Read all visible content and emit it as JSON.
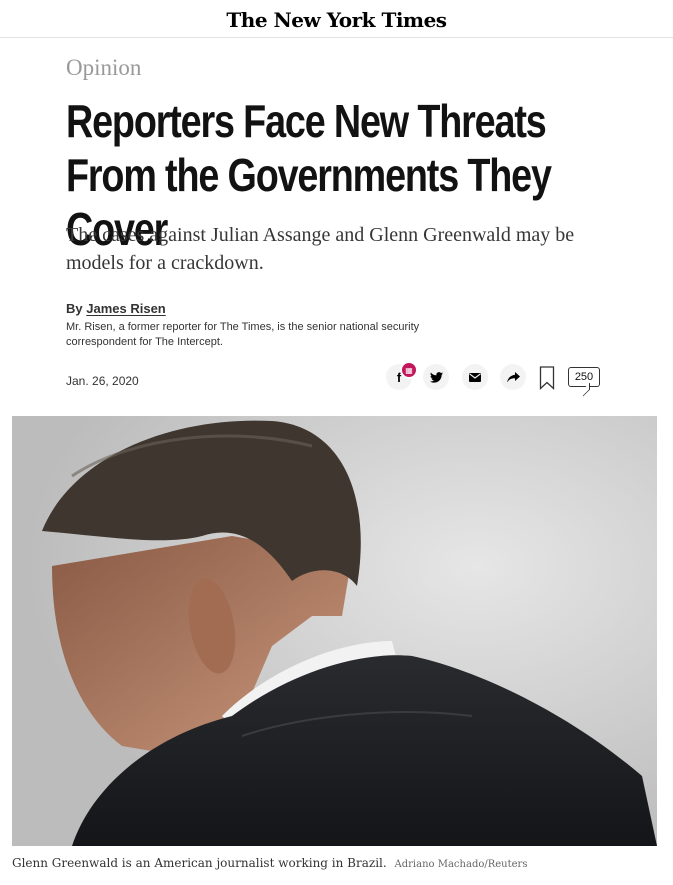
{
  "masthead": {
    "logo": "The New York Times"
  },
  "article": {
    "section": "Opinion",
    "headline": "Reporters Face New Threats From the Governments They Cover",
    "summary": "The cases against Julian Assange and Glenn Greenwald may be models for a crackdown.",
    "byline_prefix": "By",
    "author": "James Risen",
    "bio": "Mr. Risen, a former reporter for The Times, is the senior national security correspondent for The Intercept.",
    "date": "Jan. 26, 2020"
  },
  "share": {
    "facebook_label": "f",
    "comment_count": "250"
  },
  "image": {
    "caption": "Glenn Greenwald is an American journalist working in Brazil.",
    "credit": "Adriano Machado/Reuters"
  },
  "colors": {
    "gift_badge": "#c2185b",
    "section_label": "#999999"
  },
  "icons": [
    "facebook-icon",
    "gift-icon",
    "twitter-icon",
    "email-icon",
    "share-icon",
    "bookmark-icon",
    "comment-icon"
  ]
}
